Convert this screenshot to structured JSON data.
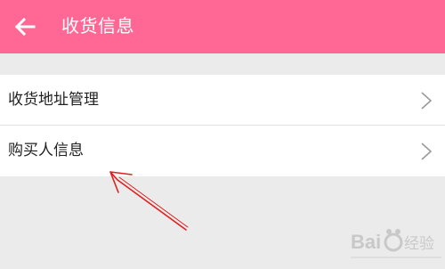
{
  "header": {
    "title": "收货信息",
    "background_color": "#ff6794",
    "back_icon": "arrow-left-icon"
  },
  "list": {
    "items": [
      {
        "label": "收货地址管理",
        "icon": "chevron-right-icon"
      },
      {
        "label": "购买人信息",
        "icon": "chevron-right-icon"
      }
    ]
  },
  "annotation": {
    "arrow_color": "#e02020"
  },
  "watermark": {
    "text": "Baidu经验"
  }
}
